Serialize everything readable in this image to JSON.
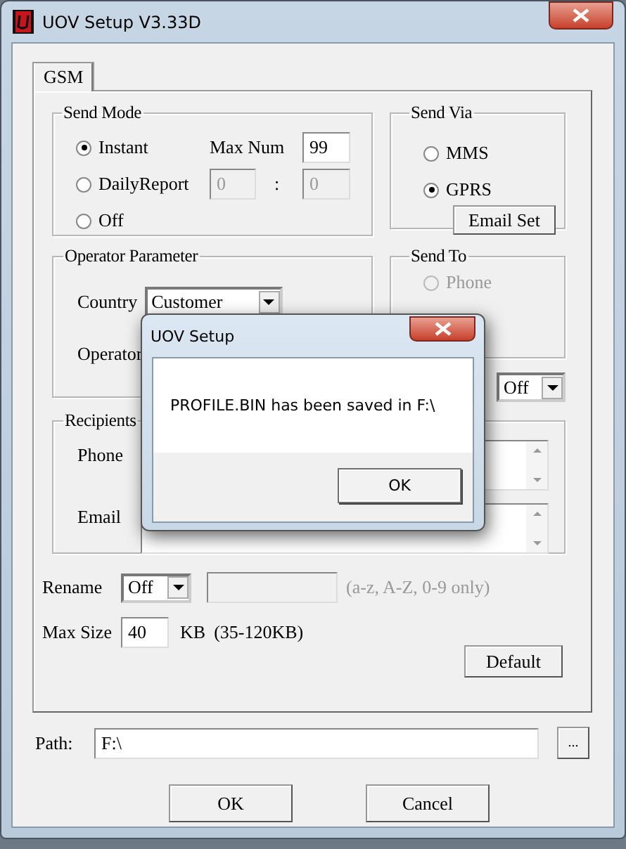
{
  "window": {
    "title": "UOV Setup V3.33D"
  },
  "tabs": [
    {
      "label": "GSM",
      "selected": true
    }
  ],
  "send_mode": {
    "title": "Send Mode",
    "options": [
      {
        "label": "Instant",
        "selected": true
      },
      {
        "label": "DailyReport",
        "selected": false
      },
      {
        "label": "Off",
        "selected": false
      }
    ],
    "max_num_label": "Max Num",
    "max_num": "99",
    "time": {
      "hour": "0",
      "separator": ":",
      "minute": "0",
      "disabled": true
    }
  },
  "send_via": {
    "title": "Send Via",
    "options": [
      {
        "label": "MMS",
        "selected": false
      },
      {
        "label": "GPRS",
        "selected": true
      }
    ],
    "button": "Email Set"
  },
  "operator_parameter": {
    "title": "Operator Parameter",
    "country_label": "Country",
    "country": "Customer",
    "operator_label": "Operator"
  },
  "send_to": {
    "title": "Send To",
    "options": [
      {
        "label": "Phone",
        "selected": false,
        "disabled": true
      }
    ],
    "dropdown": "Off"
  },
  "recipients": {
    "title": "Recipients",
    "phone_label": "Phone",
    "email_label": "Email"
  },
  "rename": {
    "label": "Rename",
    "value": "Off",
    "hint": "(a-z, A-Z, 0-9 only)"
  },
  "max_size": {
    "label": "Max Size",
    "value": "40",
    "unit": "KB",
    "range": "(35-120KB)"
  },
  "default_button": "Default",
  "path": {
    "label": "Path:",
    "value": "F:\\",
    "browse": "..."
  },
  "buttons": [
    "OK",
    "Cancel"
  ],
  "message_box": {
    "title": "UOV Setup",
    "message": "PROFILE.BIN has been saved in F:\\",
    "button": "OK"
  }
}
